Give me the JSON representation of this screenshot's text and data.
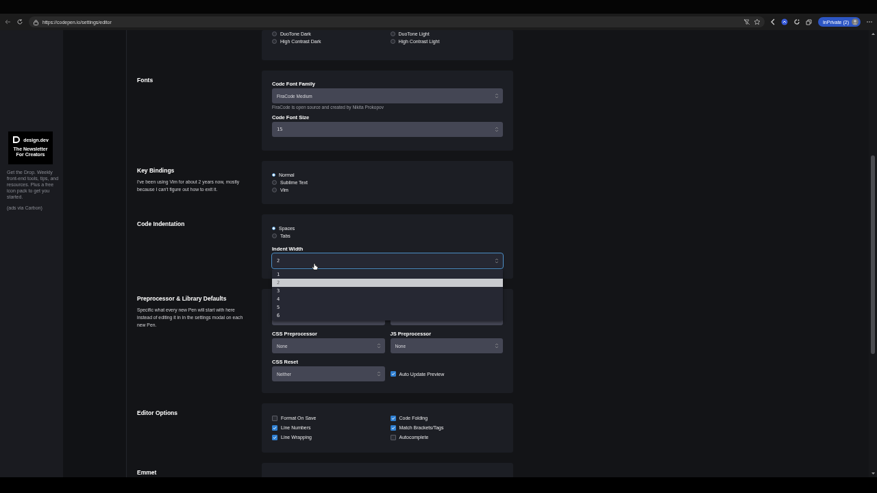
{
  "browser": {
    "url": "https://codepen.io/settings/editor",
    "profile": "InPrivate (2)"
  },
  "ad": {
    "brand": "design.dev",
    "headline": "The Newsletter For Creators",
    "text": "Get the Drop. Weekly front-end tools, tips, and resources. Plus a free icon pack to get you started.",
    "via": "(ads via Carbon)"
  },
  "sections": [
    {
      "fields": [
        {
          "kind": "radio-grid",
          "options": [
            {
              "label": "DuoTone Dark",
              "selected": false
            },
            {
              "label": "DuoTone Light",
              "selected": false
            },
            {
              "label": "High Contrast Dark",
              "selected": false
            },
            {
              "label": "High Contrast Light",
              "selected": false
            }
          ]
        }
      ]
    },
    {
      "title": "Fonts",
      "fields": [
        {
          "kind": "select",
          "label": "Code Font Family",
          "value": "FiraCode Medium",
          "hint": "FiraCode is open source and created by Nikita Prokopov"
        },
        {
          "kind": "select",
          "label": "Code Font Size",
          "value": "15"
        }
      ]
    },
    {
      "title": "Key Bindings",
      "description": "I've been using Vim for about 2 years now, mostly because I can't figure out how to exit it.",
      "fields": [
        {
          "kind": "radio-list",
          "options": [
            {
              "label": "Normal",
              "selected": true
            },
            {
              "label": "Sublime Text",
              "selected": false
            },
            {
              "label": "Vim",
              "selected": false
            }
          ]
        }
      ]
    },
    {
      "title": "Code Indentation",
      "fields": [
        {
          "kind": "radio-list",
          "options": [
            {
              "label": "Spaces",
              "selected": true
            },
            {
              "label": "Tabs",
              "selected": false
            }
          ]
        },
        {
          "kind": "select",
          "label": "Indent Width",
          "value": "2",
          "focused": true,
          "expanded": true,
          "options": [
            {
              "label": "1",
              "selected": false
            },
            {
              "label": "2",
              "selected": true
            },
            {
              "label": "3",
              "selected": false
            },
            {
              "label": "4",
              "selected": false
            },
            {
              "label": "5",
              "selected": false
            },
            {
              "label": "6",
              "selected": false
            }
          ]
        }
      ]
    },
    {
      "title": "Preprocessor & Library Defaults",
      "description": "Specific what every new Pen will start with here instead of editing it in in the settings modal on each new Pen.",
      "fields": [
        {
          "kind": "covered-pair"
        },
        {
          "kind": "select-pair",
          "selects": [
            {
              "label": "CSS Preprocessor",
              "value": "None"
            },
            {
              "label": "JS Preprocessor",
              "value": "None"
            }
          ]
        },
        {
          "kind": "select-check",
          "select": {
            "label": "CSS Reset",
            "value": "Neither"
          },
          "check": {
            "label": "Auto Update Preview",
            "checked": true
          }
        }
      ]
    },
    {
      "title": "Editor Options",
      "fields": [
        {
          "kind": "check-grid",
          "options": [
            {
              "label": "Format On Save",
              "checked": false
            },
            {
              "label": "Code Folding",
              "checked": true
            },
            {
              "label": "Line Numbers",
              "checked": true
            },
            {
              "label": "Match Brackets/Tags",
              "checked": true
            },
            {
              "label": "Line Wrapping",
              "checked": true
            },
            {
              "label": "Autocomplete",
              "checked": false
            }
          ]
        }
      ]
    },
    {
      "title": "Emmet"
    }
  ]
}
